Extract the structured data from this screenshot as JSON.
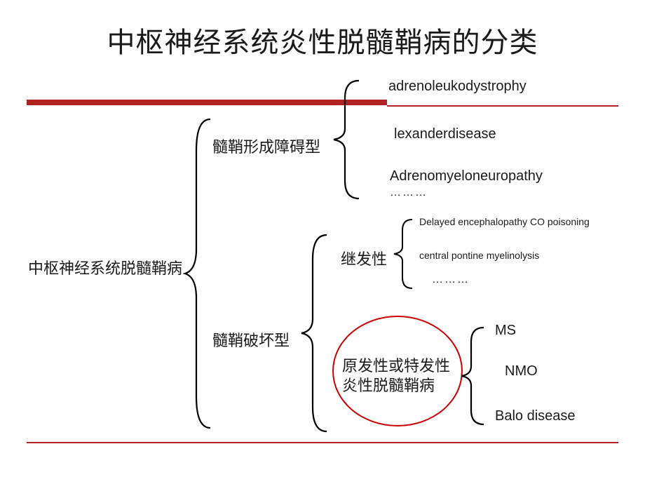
{
  "title": "中枢神经系统炎性脱髓鞘病的分类",
  "root": "中枢神经系统脱髓鞘病",
  "b1": {
    "label": "髓鞘形成障碍型",
    "items": {
      "i1": "adrenoleukodystrophy",
      "i2": "lexanderdisease",
      "i3": "Adrenomyeloneuropathy",
      "dots": "………"
    }
  },
  "b2": {
    "label": "髓鞘破坏型",
    "sub1": {
      "label": "继发性",
      "i1": "Delayed encephalopathy CO poisoning",
      "i2": "central pontine myelinolysis",
      "dots": "………"
    },
    "sub2": {
      "label_l1": "原发性或特发性",
      "label_l2": "炎性脱髓鞘病",
      "i1": "MS",
      "i2": "NMO",
      "i3": "Balo disease"
    }
  }
}
